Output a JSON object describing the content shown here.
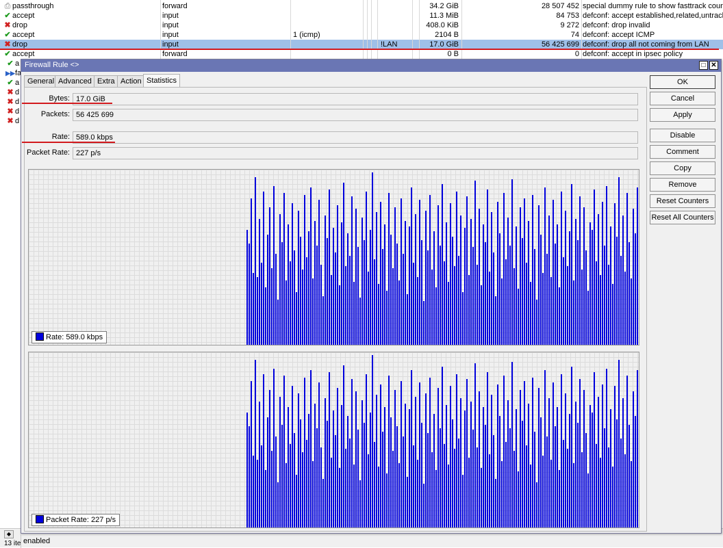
{
  "rules": {
    "rows": [
      {
        "icon": "passthrough-icon",
        "glyph": "⎙",
        "cls": "pt",
        "action": "passthrough",
        "chain": "forward",
        "protocol": "",
        "in_interface": "",
        "bytes": "34.2 GiB",
        "packets": "28 507 452",
        "comment": "special dummy rule to show fasttrack counters",
        "selected": false
      },
      {
        "icon": "accept-check-icon",
        "glyph": "✔",
        "cls": "ok",
        "action": "accept",
        "chain": "input",
        "protocol": "",
        "in_interface": "",
        "bytes": "11.3 MiB",
        "packets": "84 753",
        "comment": "defconf: accept established,related,untracked",
        "selected": false
      },
      {
        "icon": "drop-x-icon",
        "glyph": "✖",
        "cls": "no",
        "action": "drop",
        "chain": "input",
        "protocol": "",
        "in_interface": "",
        "bytes": "408.0 KiB",
        "packets": "9 272",
        "comment": "defconf: drop invalid",
        "selected": false
      },
      {
        "icon": "accept-check-icon",
        "glyph": "✔",
        "cls": "ok",
        "action": "accept",
        "chain": "input",
        "protocol": "1 (icmp)",
        "in_interface": "",
        "bytes": "2104 B",
        "packets": "74",
        "comment": "defconf: accept ICMP",
        "selected": false
      },
      {
        "icon": "drop-x-icon",
        "glyph": "✖",
        "cls": "no",
        "action": "drop",
        "chain": "input",
        "protocol": "",
        "in_interface": "!LAN",
        "bytes": "17.0 GiB",
        "packets": "56 425 699",
        "comment": "defconf: drop all not coming from LAN",
        "selected": true
      },
      {
        "icon": "accept-check-icon",
        "glyph": "✔",
        "cls": "ok",
        "action": "accept",
        "chain": "forward",
        "protocol": "",
        "in_interface": "",
        "bytes": "0 B",
        "packets": "0",
        "comment": "defconf: accept in ipsec policy",
        "selected": false
      }
    ],
    "partial_rows": [
      {
        "icon": "accept-check-icon",
        "glyph": "✔",
        "cls": "ok",
        "text": "a"
      },
      {
        "icon": "fasttrack-icon",
        "glyph": "▶▶",
        "cls": "fa",
        "text": "fa"
      },
      {
        "icon": "accept-check-icon",
        "glyph": "✔",
        "cls": "ok",
        "text": "a"
      },
      {
        "icon": "drop-x-icon",
        "glyph": "✖",
        "cls": "no",
        "text": "d"
      },
      {
        "icon": "drop-x-icon",
        "glyph": "✖",
        "cls": "no",
        "text": "d"
      },
      {
        "icon": "drop-x-icon",
        "glyph": "✖",
        "cls": "no",
        "text": "d"
      },
      {
        "icon": "drop-x-icon",
        "glyph": "✖",
        "cls": "no",
        "text": "d"
      }
    ]
  },
  "statusbar": {
    "items": "13 ite",
    "status": "enabled",
    "scroll_glyph": "◆"
  },
  "dialog": {
    "title": "Firewall Rule <>",
    "restore_glyph": "□",
    "close_glyph": "✕",
    "tabs": [
      "General",
      "Advanced",
      "Extra",
      "Action",
      "Statistics"
    ],
    "active_tab": "Statistics",
    "fields": {
      "bytes_label": "Bytes:",
      "bytes": "17.0 GiB",
      "packets_label": "Packets:",
      "packets": "56 425 699",
      "rate_label": "Rate:",
      "rate": "589.0 kbps",
      "packet_rate_label": "Packet Rate:",
      "packet_rate": "227 p/s"
    },
    "graphs": {
      "rate_legend": "Rate:  589.0 kbps",
      "packet_rate_legend": "Packet Rate:  227 p/s"
    },
    "buttons": [
      "OK",
      "Cancel",
      "Apply",
      "Disable",
      "Comment",
      "Copy",
      "Remove",
      "Reset Counters",
      "Reset All Counters"
    ]
  },
  "colors": {
    "bar": "#0000dd",
    "grid": "#dcdcdc",
    "titlebar": "#6a76b4",
    "selected_row": "#9fc0e8",
    "annotation": "#d2191d"
  },
  "chart_data": [
    {
      "type": "bar",
      "title": "Rate",
      "unit": "relative height (0-1)",
      "values": [
        0.66,
        0.58,
        0.84,
        0.41,
        0.96,
        0.39,
        0.72,
        0.47,
        0.88,
        0.33,
        0.63,
        0.79,
        0.44,
        0.91,
        0.52,
        0.26,
        0.75,
        0.59,
        0.87,
        0.37,
        0.69,
        0.48,
        0.81,
        0.54,
        0.3,
        0.77,
        0.62,
        0.43,
        0.86,
        0.5,
        0.65,
        0.9,
        0.38,
        0.71,
        0.57,
        0.83,
        0.46,
        0.28,
        0.74,
        0.61,
        0.89,
        0.4,
        0.67,
        0.53,
        0.8,
        0.34,
        0.7,
        0.93,
        0.45,
        0.64,
        0.51,
        0.85,
        0.36,
        0.78,
        0.56,
        0.27,
        0.73,
        0.6,
        0.88,
        0.42,
        0.66,
        0.99,
        0.49,
        0.76,
        0.35,
        0.82,
        0.55,
        0.69,
        0.31,
        0.87,
        0.63,
        0.44,
        0.79,
        0.58,
        0.37,
        0.84,
        0.52,
        0.71,
        0.29,
        0.68,
        0.9,
        0.47,
        0.75,
        0.39,
        0.83,
        0.6,
        0.25,
        0.77,
        0.54,
        0.86,
        0.43,
        0.65,
        0.33,
        0.8,
        0.57,
        0.92,
        0.48,
        0.7,
        0.36,
        0.81,
        0.62,
        0.45,
        0.88,
        0.51,
        0.74,
        0.3,
        0.67,
        0.85,
        0.4,
        0.72,
        0.56,
        0.94,
        0.46,
        0.78,
        0.34,
        0.69,
        0.59,
        0.89,
        0.42,
        0.76,
        0.53,
        0.28,
        0.82,
        0.64,
        0.38,
        0.87,
        0.49,
        0.73,
        0.57,
        0.95,
        0.44,
        0.68,
        0.32,
        0.79,
        0.61,
        0.84,
        0.47,
        0.71,
        0.36,
        0.86,
        0.55,
        0.26,
        0.8,
        0.63,
        0.41,
        0.9,
        0.52,
        0.74,
        0.39,
        0.83,
        0.58,
        0.69,
        0.33,
        0.88,
        0.5,
        0.77,
        0.45,
        0.65,
        0.92,
        0.37,
        0.72,
        0.6,
        0.85,
        0.43,
        0.79,
        0.54,
        0.31,
        0.7,
        0.66,
        0.89,
        0.48,
        0.75,
        0.4,
        0.82,
        0.57,
        0.91,
        0.46,
        0.68,
        0.35,
        0.81,
        0.62,
        0.96,
        0.51,
        0.74,
        0.42,
        0.87,
        0.59,
        0.38,
        0.78,
        0.64,
        0.9,
        0.47,
        0.69,
        0.56,
        0.71
      ]
    },
    {
      "type": "bar",
      "title": "Packet Rate",
      "unit": "relative height (0-1)",
      "values": "same shape as Rate"
    }
  ]
}
